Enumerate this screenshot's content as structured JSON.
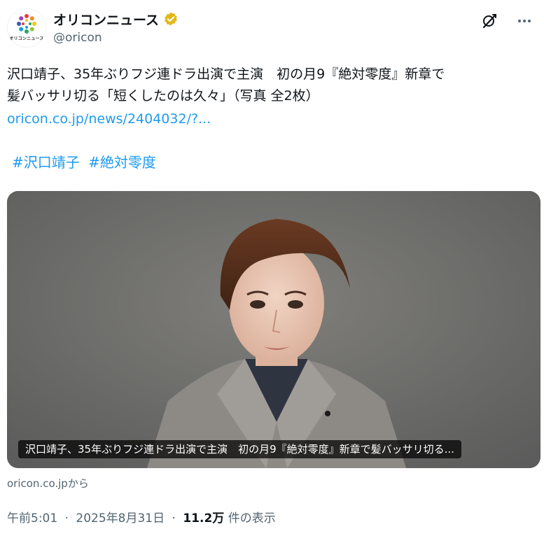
{
  "account": {
    "display_name": "オリコンニュース",
    "handle": "@oricon",
    "avatar_caption": "オリコンニュース",
    "verified_color": "#e2b719"
  },
  "post": {
    "text_line1": "沢口靖子、35年ぶりフジ連ドラ出演で主演　初の月9『絶対零度』新章で",
    "text_line2": "髪バッサリ切る「短くしたのは久々」（写真 全2枚）",
    "link": "oricon.co.jp/news/2404032/?...",
    "hashtags": [
      "#沢口靖子",
      "#絶対零度"
    ]
  },
  "media": {
    "caption": "沢口靖子、35年ぶりフジ連ドラ出演で主演　初の月9『絶対零度』新章で髪バッサリ切る...",
    "source": "oricon.co.jpから"
  },
  "meta": {
    "time": "午前5:01",
    "separator": "·",
    "date": "2025年8月31日",
    "views_count": "11.2万",
    "views_label": "件の表示"
  },
  "icons": {
    "grok": "grok-icon",
    "more": "more-icon",
    "verified": "verified-badge-icon"
  },
  "colors": {
    "link": "#1d9bf0",
    "secondary_text": "#536471",
    "primary_text": "#0f1419"
  }
}
